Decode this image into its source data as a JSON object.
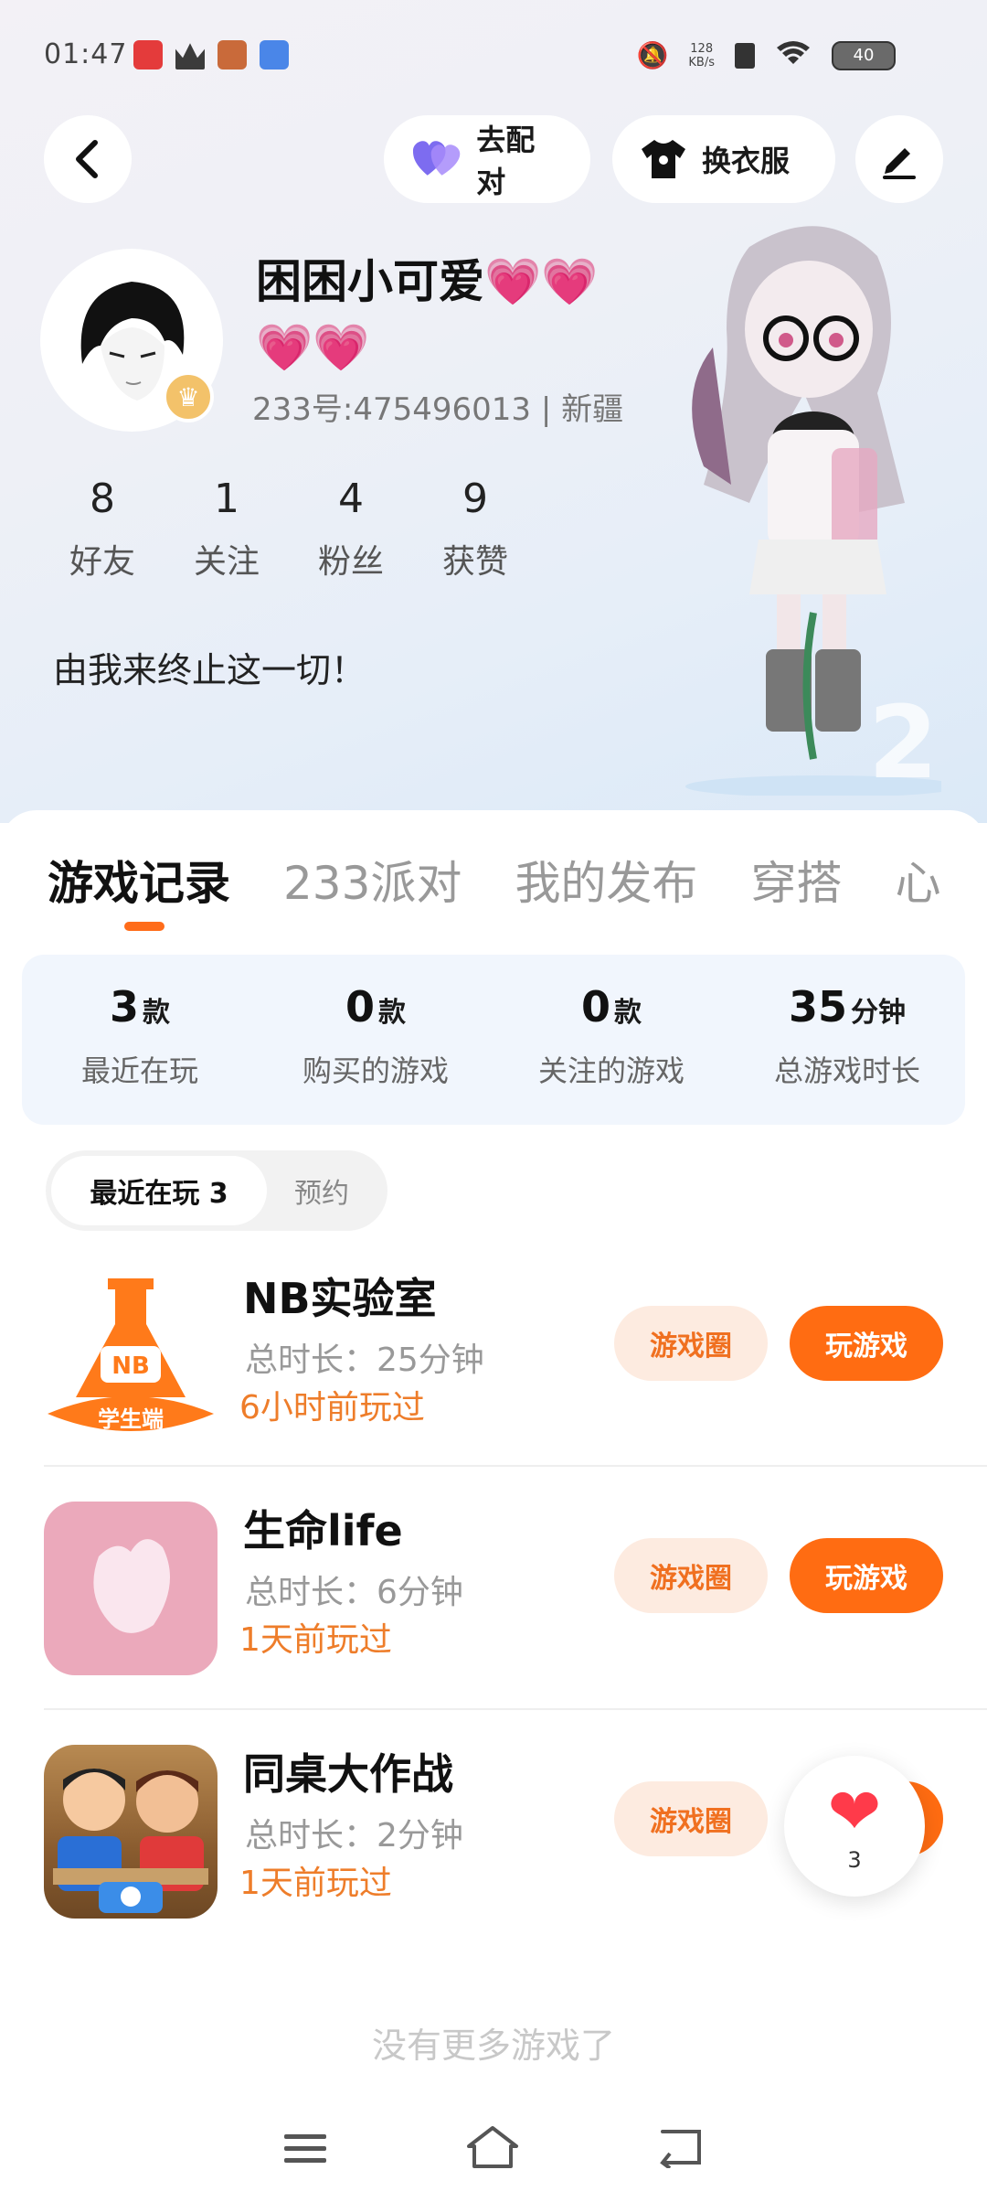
{
  "status_bar": {
    "time": "01:47",
    "net_speed_value": "128",
    "net_speed_unit": "KB/s",
    "battery": "40"
  },
  "top_actions": {
    "match_label": "去配对",
    "outfit_label": "换衣服"
  },
  "profile": {
    "nickname": "困困小可爱",
    "hearts_line1": "💗💗",
    "hearts_line2": "💗💗",
    "uid_line": "233号:475496013 | 新疆",
    "bio": "由我来终止这一切！"
  },
  "stats": [
    {
      "value": "8",
      "label": "好友"
    },
    {
      "value": "1",
      "label": "关注"
    },
    {
      "value": "4",
      "label": "粉丝"
    },
    {
      "value": "9",
      "label": "获赞"
    }
  ],
  "tabs": [
    "游戏记录",
    "233派对",
    "我的发布",
    "穿搭",
    "心"
  ],
  "summary": [
    {
      "value": "3",
      "unit": "款",
      "label": "最近在玩"
    },
    {
      "value": "0",
      "unit": "款",
      "label": "购买的游戏"
    },
    {
      "value": "0",
      "unit": "款",
      "label": "关注的游戏"
    },
    {
      "value": "35",
      "unit": "分钟",
      "label": "总游戏时长"
    }
  ],
  "filters": {
    "recent": "最近在玩 3",
    "reserve": "预约"
  },
  "games": [
    {
      "title": "NB实验室",
      "duration": "总时长：25分钟",
      "last_played": "6小时前玩过",
      "icon_text": "NB",
      "icon_badge": "学生端"
    },
    {
      "title": "生命life",
      "duration": "总时长：6分钟",
      "last_played": "1天前玩过"
    },
    {
      "title": "同桌大作战",
      "duration": "总时长：2分钟",
      "last_played": "1天前玩过"
    }
  ],
  "game_buttons": {
    "circle": "游戏圈",
    "play": "玩游戏"
  },
  "no_more": "没有更多游戏了",
  "like_count": "3"
}
